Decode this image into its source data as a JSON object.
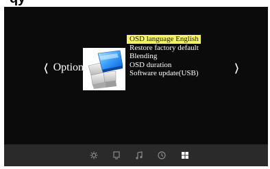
{
  "nav": {
    "left_label": "Option",
    "left_arrow": "❬",
    "right_arrow": "❭"
  },
  "menu": {
    "items": [
      {
        "label": "OSD language English",
        "selected": true
      },
      {
        "label": "Restore factory default",
        "selected": false
      },
      {
        "label": "Blending",
        "selected": false
      },
      {
        "label": "OSD duration",
        "selected": false
      },
      {
        "label": "Software update(USB)",
        "selected": false
      }
    ]
  },
  "bottom_bar": {
    "icons": [
      {
        "name": "picture-settings-icon",
        "active": false
      },
      {
        "name": "screen-icon",
        "active": false
      },
      {
        "name": "music-note-icon",
        "active": false
      },
      {
        "name": "clock-icon",
        "active": false
      },
      {
        "name": "option-grid-icon",
        "active": true
      }
    ]
  },
  "colors": {
    "screen_bg": "#0b0b0b",
    "highlight": "#f4f269",
    "bar_bg": "#2a2a2a",
    "icon_inactive": "#8a8a8a",
    "icon_active": "#ffffff"
  }
}
